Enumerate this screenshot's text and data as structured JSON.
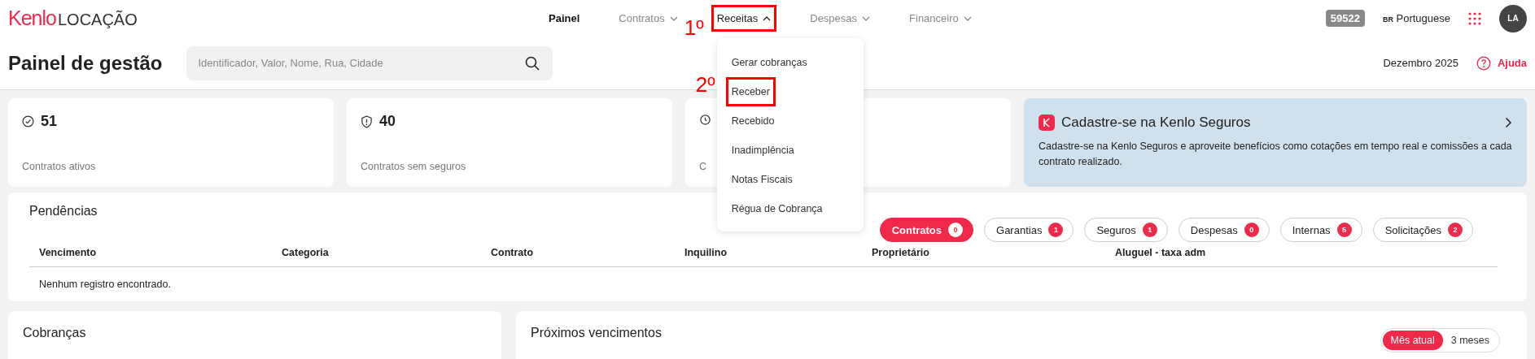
{
  "header": {
    "logo": {
      "brand": "Kenlo",
      "product": "LOCAÇÃO"
    },
    "nav": [
      {
        "label": "Painel",
        "selected": true,
        "dropdown": false,
        "expanded": false
      },
      {
        "label": "Contratos",
        "selected": false,
        "dropdown": true,
        "expanded": false
      },
      {
        "label": "Receitas",
        "selected": false,
        "dropdown": true,
        "expanded": true,
        "annotation": "1º"
      },
      {
        "label": "Despesas",
        "selected": false,
        "dropdown": true,
        "expanded": false
      },
      {
        "label": "Financeiro",
        "selected": false,
        "dropdown": true,
        "expanded": false
      }
    ],
    "badge": "59522",
    "language": {
      "flag": "BR",
      "label": "Portuguese"
    },
    "avatar": "LA"
  },
  "title_bar": {
    "title": "Painel de gestão",
    "search": {
      "placeholder": "Identificador, Valor, Nome, Rua, Cidade"
    },
    "period": "Dezembro 2025",
    "help": "Ajuda"
  },
  "stats": [
    {
      "value": "51",
      "label": "Contratos ativos"
    },
    {
      "value": "40",
      "label": "Contratos sem seguros"
    },
    {
      "label": "C"
    }
  ],
  "promo": {
    "title": "Cadastre-se na Kenlo Seguros",
    "text": "Cadastre-se na Kenlo Seguros e aproveite benefícios como cotações em tempo real e comissões a cada contrato realizado."
  },
  "dropdown": {
    "items": [
      {
        "label": "Gerar cobranças"
      },
      {
        "label": "Receber",
        "annotation": "2º"
      },
      {
        "label": "Recebido"
      },
      {
        "label": "Inadimplência"
      },
      {
        "label": "Notas Fiscais"
      },
      {
        "label": "Régua de Cobrança"
      }
    ]
  },
  "pendencias": {
    "title": "Pendências",
    "filters": [
      {
        "label": "Contratos",
        "count": "0",
        "selected": true
      },
      {
        "label": "Garantias",
        "count": "1",
        "selected": false
      },
      {
        "label": "Seguros",
        "count": "1",
        "selected": false
      },
      {
        "label": "Despesas",
        "count": "0",
        "selected": false
      },
      {
        "label": "Internas",
        "count": "5",
        "selected": false
      },
      {
        "label": "Solicitações",
        "count": "2",
        "selected": false
      }
    ],
    "columns": [
      "Vencimento",
      "Categoria",
      "Contrato",
      "Inquilino",
      "Proprietário",
      "Aluguel - taxa adm"
    ],
    "empty": "Nenhum registro encontrado."
  },
  "cobrancas": {
    "title": "Cobranças"
  },
  "proximos": {
    "title": "Próximos vencimentos",
    "toggle": [
      {
        "label": "Mês atual",
        "selected": true
      },
      {
        "label": "3 meses",
        "selected": false
      }
    ]
  }
}
